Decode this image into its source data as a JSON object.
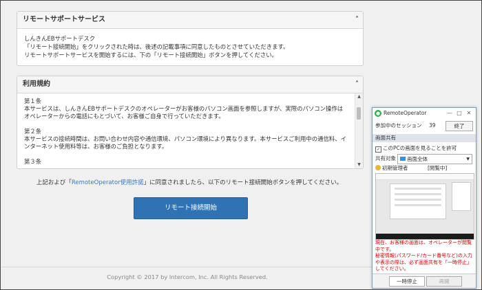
{
  "panel1": {
    "title": "リモートサポートサービス",
    "line1": "しんきんEBサポートデスク",
    "line2": "「リモート接続開始」をクリックされた時は、後述の記載事項に同意したものとさせていただきます。",
    "line3": "リモートサポートサービスを開始するには、下の「リモート接続開始」ボタンを押してください。"
  },
  "panel2": {
    "title": "利用規約",
    "art1_title": "第１条",
    "art1_body": "本サービスは、しんきんEBサポートデスクのオペレーターがお客様のパソコン画面を参照しますが、実際のパソコン操作はオペレーターからの電話にもとづいて、お客様ご自身で行っていただきます。",
    "art2_title": "第２条",
    "art2_body": "本サービスの接続時間は、お問い合わせ内容や通信環境、パソコン環境により異なります。本サービスご利用中の通信料、インターネット使用料等は、お客様のご負担となります。",
    "art3_title": "第３条"
  },
  "consent": {
    "pre": "上記および「",
    "link": "RemoteOperator使用許諾",
    "post": "」に同意されましたら、以下のリモート接続開始ボタンを押してください。"
  },
  "cta": {
    "label": "リモート接続開始"
  },
  "footer": {
    "copyright": "Copyright © 2017 by Intercom, Inc. All Rights Reserved."
  },
  "remote_operator": {
    "title": "RemoteOperator",
    "session_label": "参加中のセッション",
    "session_count": "39",
    "end_button": "終了",
    "section_label": "画面共有",
    "allow_check_label": "このPCの画面を見ることを許可",
    "share_target_label": "共有対象",
    "share_target_value": "画面全体",
    "operator_name": "初期管理者",
    "operator_status": "[閲覧中]",
    "warning": "現在、お客様の画面は、オペレーターが閲覧中です。\n秘密情報(パスワード/カード番号など)の入力や表示の際は、必ず画面共有を「一時停止」してください。",
    "pause_button": "一時停止",
    "resume_button": "再開"
  }
}
